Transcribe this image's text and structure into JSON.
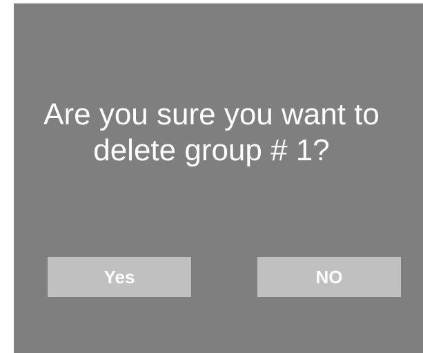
{
  "dialog": {
    "message_line1": "Are you sure you want to",
    "message_line2": "delete group # 1?",
    "yes_label": "Yes",
    "no_label": "NO"
  },
  "colors": {
    "dialog_background": "#7f7f7f",
    "button_background": "#c0c0c0",
    "text": "#ffffff"
  }
}
